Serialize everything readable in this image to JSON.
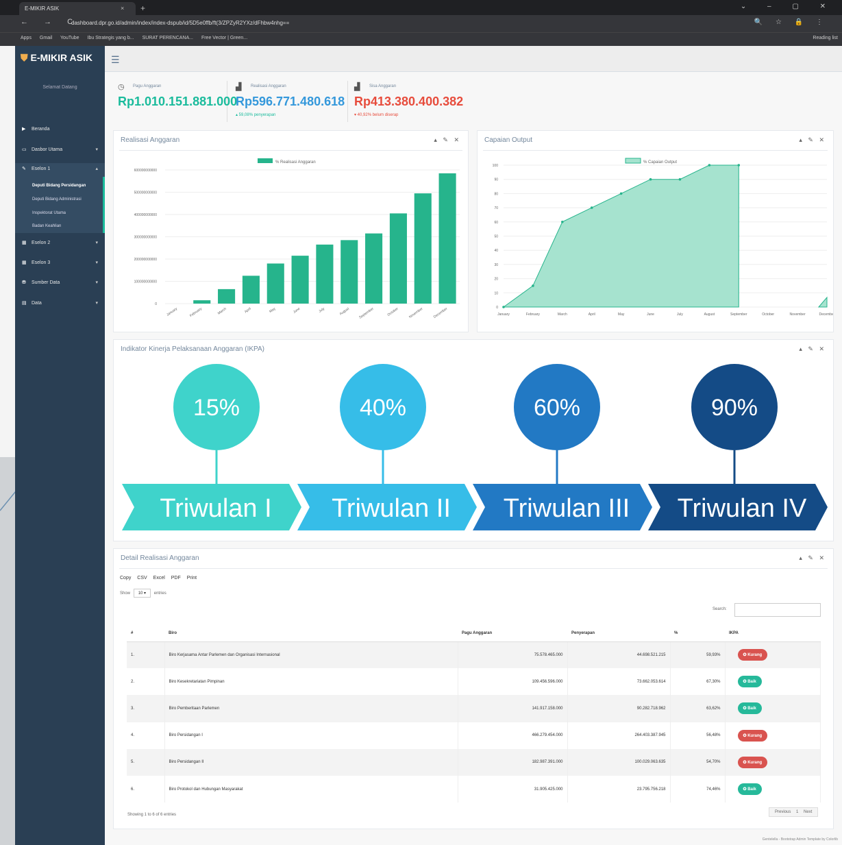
{
  "browser": {
    "tab_title": "E-MIKIR ASIK",
    "tab_close": "×",
    "new_tab": "+",
    "window_controls": "⌄ – ▢ ✕",
    "nav_buttons": "← → C",
    "url": "dashboard.dpr.go.id/admin/index/index-dspub/id/5D5e0ffb/ft(3/ZPZyR2YXz/dFhbw4nhg==",
    "toolbar_icons": "🔍 ☆ 🔒 ⋮",
    "bookmarks": [
      "Apps",
      "Gmail",
      "YouTube",
      "Ibu Strategis yang b...",
      "SURAT PERENCANA...",
      "Free Vector | Green..."
    ],
    "reading_list": "Reading list"
  },
  "sidebar": {
    "brand": "E-MIKIR ASIK",
    "welcome": "Selamat Datang",
    "menu": [
      {
        "label": "Beranda",
        "icon": "▶",
        "caret": ""
      },
      {
        "label": "Dasbor Utama",
        "icon": "▭",
        "caret": "▾"
      },
      {
        "label": "Eselon 1",
        "icon": "✎",
        "caret": "▴"
      },
      {
        "label": "Eselon 2",
        "icon": "▦",
        "caret": "▾"
      },
      {
        "label": "Eselon 3",
        "icon": "▦",
        "caret": "▾"
      },
      {
        "label": "Sumber Data",
        "icon": "⛃",
        "caret": "▾"
      },
      {
        "label": "Data",
        "icon": "▤",
        "caret": "▾"
      }
    ],
    "submenu": [
      "Deputi Bidang Persidangan",
      "Deputi Bidang Administrasi",
      "Inspektorat Utama",
      "Badan Keahlian"
    ]
  },
  "topnav": {
    "menu_icon": "☰"
  },
  "stats": [
    {
      "label": "Pagu Anggaran",
      "icon": "◷",
      "value": "Rp1.010.151.881.000",
      "sub": "",
      "color": "#1abb9c"
    },
    {
      "label": "Realisasi Anggaran",
      "icon": "▟",
      "value": "Rp596.771.480.618",
      "sub": "▴ 59,08% penyerapan",
      "color": "#3498db"
    },
    {
      "label": "Sisa Anggaran",
      "icon": "▟",
      "value": "Rp413.380.400.382",
      "sub": "▾ 40,92% belum diserap",
      "color": "#e74c3c"
    }
  ],
  "panels": {
    "realisasi": {
      "title": "Realisasi Anggaran",
      "tools": "▴ ✎ ✕"
    },
    "capaian": {
      "title": "Capaian Output",
      "tools": "▴ ✎ ✕"
    },
    "ikpa": {
      "title": "Indikator Kinerja Pelaksanaan Anggaran (IKPA)",
      "tools": "▴ ✎ ✕"
    },
    "detail": {
      "title": "Detail Realisasi Anggaran",
      "tools": "▴ ✎ ✕"
    }
  },
  "ikpa": [
    {
      "percent": "15%",
      "label": "Triwulan I",
      "color": "#3fd3cb"
    },
    {
      "percent": "40%",
      "label": "Triwulan II",
      "color": "#36bde8"
    },
    {
      "percent": "60%",
      "label": "Triwulan III",
      "color": "#2279c4"
    },
    {
      "percent": "90%",
      "label": "Triwulan IV",
      "color": "#144b86"
    }
  ],
  "chart_data": [
    {
      "type": "bar",
      "legend": "% Realisasi Anggaran",
      "color": "#26b48c",
      "categories": [
        "January",
        "February",
        "March",
        "April",
        "May",
        "June",
        "July",
        "August",
        "September",
        "October",
        "November",
        "December"
      ],
      "values": [
        0,
        15000000000,
        65000000000,
        125000000000,
        180000000000,
        215000000000,
        265000000000,
        285000000000,
        315000000000,
        405000000000,
        495000000000,
        585000000000
      ],
      "ytick_labels": [
        "0",
        "100000000000",
        "200000000000",
        "300000000000",
        "400000000000",
        "500000000000",
        "600000000000"
      ],
      "ylim": [
        0,
        600000000000
      ]
    },
    {
      "type": "area",
      "legend": "% Capaian Output",
      "color": "#26b48c",
      "categories": [
        "January",
        "February",
        "March",
        "April",
        "May",
        "June",
        "July",
        "August",
        "September",
        "October",
        "November",
        "December"
      ],
      "values": [
        0,
        15,
        60,
        70,
        80,
        90,
        90,
        100,
        100,
        0,
        0,
        0
      ],
      "ytick_labels": [
        "0",
        "10",
        "20",
        "30",
        "40",
        "50",
        "60",
        "70",
        "80",
        "90",
        "100"
      ],
      "ylim": [
        0,
        100
      ]
    }
  ],
  "table": {
    "buttons": [
      "Copy",
      "CSV",
      "Excel",
      "PDF",
      "Print"
    ],
    "show_label": "Show",
    "entries_value": "10",
    "entries_label": "entries",
    "search_label": "Search:",
    "headers": [
      "#",
      "Biro",
      "Pagu Anggaran",
      "Penyerapan",
      "%",
      "IKPA"
    ],
    "rows": [
      {
        "no": "1.",
        "biro": "Biro Kerjasama Antar Parlemen dan Organisasi Internasional",
        "pagu": "75.578.465.000",
        "serap": "44.698.521.215",
        "pct": "59,93%",
        "ikpa": "✪ Kurang",
        "status": "red"
      },
      {
        "no": "2.",
        "biro": "Biro Kesekretariatan Pimpinan",
        "pagu": "109.456.596.000",
        "serap": "73.662.053.614",
        "pct": "67,30%",
        "ikpa": "✪ Baik",
        "status": "green"
      },
      {
        "no": "3.",
        "biro": "Biro Pemberitaan Parlemen",
        "pagu": "141.917.158.000",
        "serap": "90.282.718.962",
        "pct": "63,62%",
        "ikpa": "✪ Baik",
        "status": "green"
      },
      {
        "no": "4.",
        "biro": "Biro Persidangan I",
        "pagu": "466.279.454.000",
        "serap": "264.403.387.945",
        "pct": "56,48%",
        "ikpa": "✪ Kurang",
        "status": "red"
      },
      {
        "no": "5.",
        "biro": "Biro Persidangan II",
        "pagu": "182.987.391.000",
        "serap": "100.029.063.635",
        "pct": "54,70%",
        "ikpa": "✪ Kurang",
        "status": "red"
      },
      {
        "no": "6.",
        "biro": "Biro Protokol dan Hubungan Masyarakat",
        "pagu": "31.905.425.000",
        "serap": "23.795.756.218",
        "pct": "74,46%",
        "ikpa": "✪ Baik",
        "status": "green"
      }
    ],
    "info": "Showing 1 to 6 of 6 entries",
    "pager": [
      "Previous",
      "1",
      "Next"
    ]
  },
  "footer": "Gentelella - Bootstrap Admin Template by Colorlib"
}
